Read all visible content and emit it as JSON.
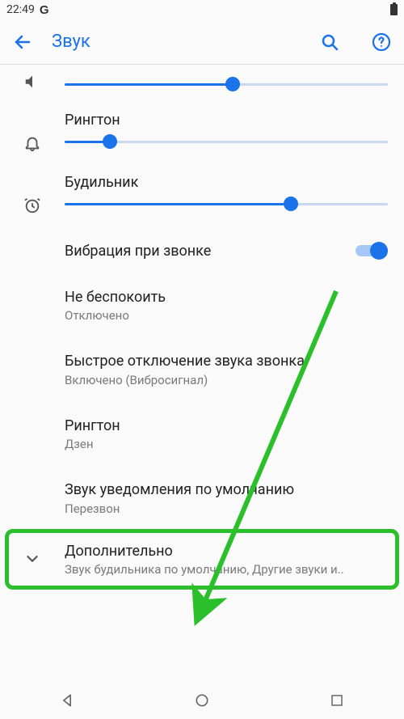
{
  "status": {
    "time": "22:49",
    "g_icon_label": "G"
  },
  "appbar": {
    "title": "Звук"
  },
  "sliders": {
    "first": {
      "value": 52
    },
    "ringtone": {
      "label": "Рингтон",
      "value": 14
    },
    "alarm": {
      "label": "Будильник",
      "value": 70
    }
  },
  "vibrate": {
    "label": "Вибрация при звонке",
    "on": true
  },
  "items": {
    "dnd": {
      "title": "Не беспокоить",
      "sub": "Отключено"
    },
    "quick_mute": {
      "title": "Быстрое отключение звука звонка",
      "sub": "Включено (Вибросигнал)"
    },
    "ringtone": {
      "title": "Рингтон",
      "sub": "Дзен"
    },
    "notif": {
      "title": "Звук уведомления по умолчанию",
      "sub": "Перезвон"
    },
    "advanced": {
      "title": "Дополнительно",
      "sub": "Звук будильника по умолчанию, Другие звуки и.."
    }
  }
}
